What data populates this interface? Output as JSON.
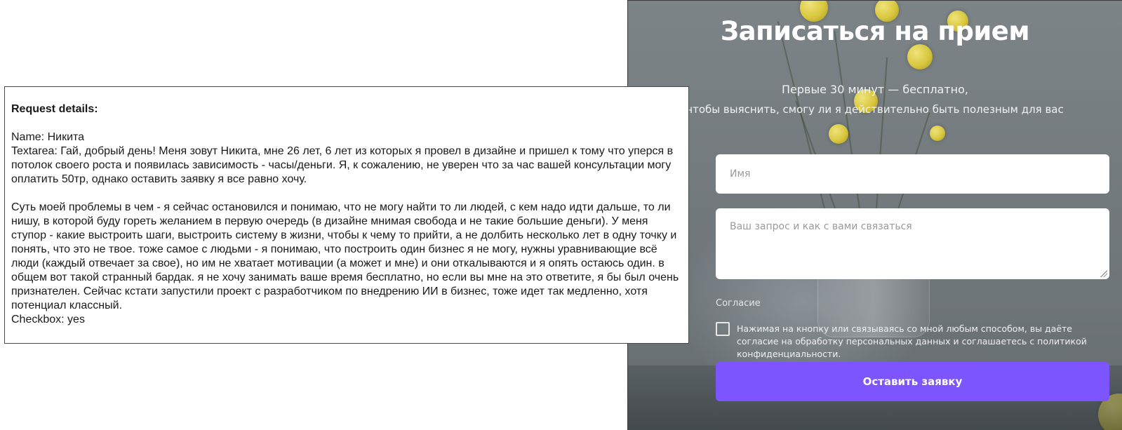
{
  "details": {
    "title": "Request details:",
    "name_line": "Name: Никита",
    "textarea_line": "Textarea: Гай, добрый день! Меня зовут Никита, мне 26 лет, 6 лет из которых я провел в дизайне и пришел к тому что уперся в потолок своего роста и появилась зависимость - часы/деньги. Я, к сожалению, не уверен что за час вашей консультации могу оплатить 50тр, однако оставить заявку я все равно хочу.",
    "paragraph2": "Суть моей проблемы в чем - я сейчас остановился и понимаю, что не могу найти то ли людей, с кем надо идти дальше, то ли нишу, в которой буду гореть желанием в первую очередь (в дизайне мнимая свобода и не такие большие деньги). У меня ступор - какие выстроить шаги, выстроить систему в жизни, чтобы к чему то прийти, а не долбить несколько лет в одну точку и понять, что это не твое. тоже самое с людьми - я понимаю, что построить один бизнес я не могу, нужны уравнивающие всё люди (каждый отвечает за свое), но им не хватает мотивации (а может и мне) и они откалываются и я опять остаюсь один. в общем вот такой странный бардак. я не хочу занимать ваше время бесплатно, но если вы мне на это ответите, я бы был очень признателен. Сейчас кстати запустили проект с разработчиком по внедрению ИИ в бизнес, тоже идет так медленно, хотя потенциал классный.",
    "checkbox_line": "Checkbox: yes"
  },
  "booking": {
    "title": "Записаться на прием",
    "subtitle_line1": "Первые 30 минут — бесплатно,",
    "subtitle_line2": "чтобы выяснить, смогу ли я действительно быть полезным для вас",
    "name_placeholder": "Имя",
    "request_placeholder": "Ваш запрос и как с вами связаться",
    "consent_label": "Согласие",
    "consent_text": "Нажимая на кнопку или связываясь со мной любым способом, вы даёте согласие на обработку персональных данных и соглашаетесь с политикой конфиденциальности.",
    "submit_label": "Оставить заявку"
  },
  "colors": {
    "accent": "#7c55ff",
    "panel_bg": "#747b7f"
  }
}
